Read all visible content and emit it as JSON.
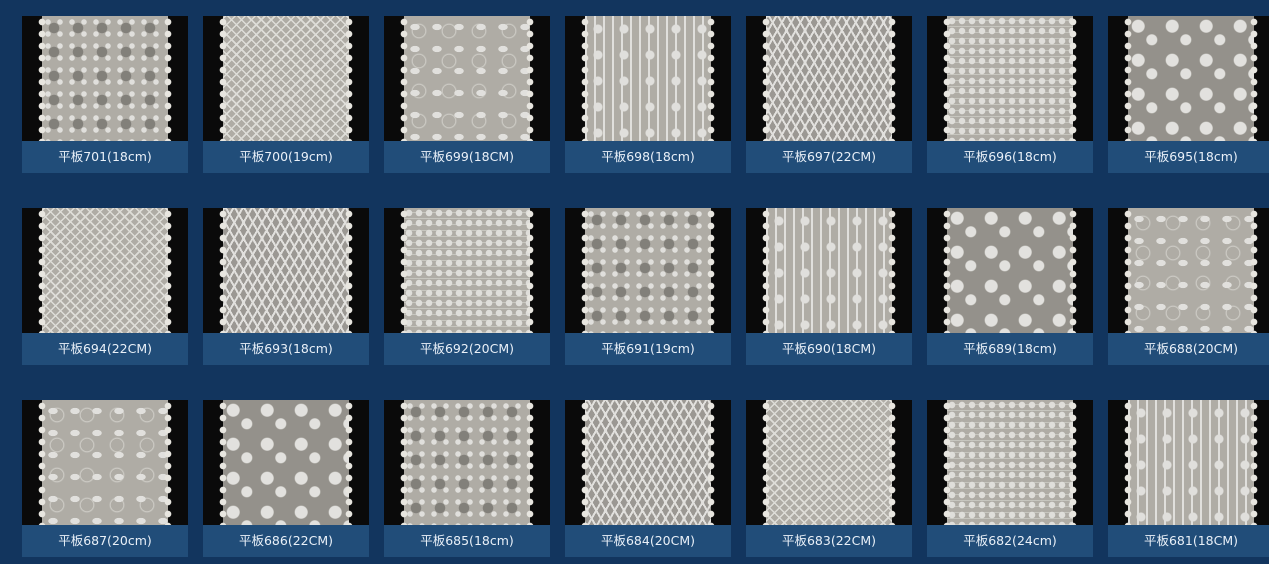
{
  "products": [
    {
      "label": "平板701(18cm)"
    },
    {
      "label": "平板700(19cm)"
    },
    {
      "label": "平板699(18CM)"
    },
    {
      "label": "平板698(18cm)"
    },
    {
      "label": "平板697(22CM)"
    },
    {
      "label": "平板696(18cm)"
    },
    {
      "label": "平板695(18cm)"
    },
    {
      "label": "平板694(22CM)"
    },
    {
      "label": "平板693(18cm)"
    },
    {
      "label": "平板692(20CM)"
    },
    {
      "label": "平板691(19cm)"
    },
    {
      "label": "平板690(18CM)"
    },
    {
      "label": "平板689(18cm)"
    },
    {
      "label": "平板688(20CM)"
    },
    {
      "label": "平板687(20cm)"
    },
    {
      "label": "平板686(22CM)"
    },
    {
      "label": "平板685(18cm)"
    },
    {
      "label": "平板684(20CM)"
    },
    {
      "label": "平板683(22CM)"
    },
    {
      "label": "平板682(24cm)"
    },
    {
      "label": "平板681(18CM)"
    }
  ]
}
